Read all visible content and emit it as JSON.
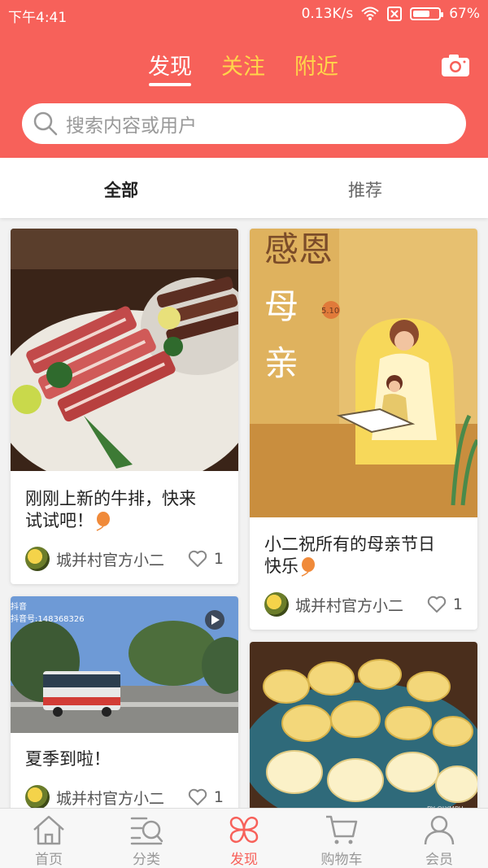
{
  "status_bar": {
    "time": "下午4:41",
    "network_speed": "0.13K/s",
    "battery": "67%",
    "battery_level": 0.67
  },
  "header": {
    "tabs": [
      {
        "label": "发现",
        "active": true
      },
      {
        "label": "关注",
        "active": false
      },
      {
        "label": "附近",
        "active": false
      }
    ],
    "camera_icon": "camera-icon",
    "search_placeholder": "搜索内容或用户"
  },
  "subtabs": [
    {
      "label": "全部",
      "active": true
    },
    {
      "label": "推荐",
      "active": false
    }
  ],
  "feed": [
    {
      "title_line1": "刚刚上新的牛排，快来",
      "title_line2": "试试吧！",
      "author": "城并村官方小二",
      "likes": "1",
      "image": "steak-photo"
    },
    {
      "title_line1": "小二祝所有的母亲节日",
      "title_line2": "快乐",
      "author": "城并村官方小二",
      "likes": "1",
      "image": "mothers-day-illustration"
    },
    {
      "title_line1": "夏季到啦！",
      "author": "城并村官方小二",
      "likes": "1",
      "image": "street-bus-photo",
      "tiktok_label": "抖音",
      "tiktok_id": "抖音号:148368326"
    },
    {
      "image": "banana-snack-photo",
      "watermark": "BY OLYMPU"
    }
  ],
  "bottom_nav": [
    {
      "label": "首页",
      "icon": "home-icon",
      "active": false
    },
    {
      "label": "分类",
      "icon": "category-icon",
      "active": false
    },
    {
      "label": "发现",
      "icon": "discover-icon",
      "active": true
    },
    {
      "label": "购物车",
      "icon": "cart-icon",
      "active": false
    },
    {
      "label": "会员",
      "icon": "member-icon",
      "active": false
    }
  ],
  "colors": {
    "brand": "#f7615a",
    "tab_inactive": "#ffd54a"
  }
}
